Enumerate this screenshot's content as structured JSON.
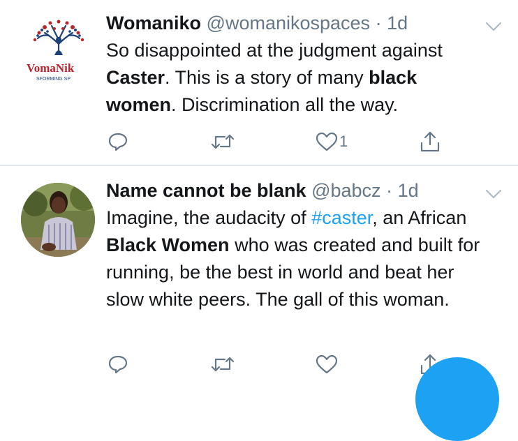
{
  "tweets": [
    {
      "name": "Womaniko",
      "handle": "@womanikospaces",
      "separator": "·",
      "time": "1d",
      "text_parts": [
        {
          "t": "So disappointed at the judgment against "
        },
        {
          "t": "Caster",
          "b": true
        },
        {
          "t": ". This is a story of many "
        },
        {
          "t": "black women",
          "b": true
        },
        {
          "t": ". Discrimination all the way."
        }
      ],
      "avatar": {
        "logo_text": "VomaNik",
        "logo_subtext": "SFORMING SP"
      },
      "actions": {
        "reply_count": "",
        "retweet_count": "",
        "like_count": "1"
      },
      "icons": [
        "reply-icon",
        "retweet-icon",
        "heart-icon",
        "share-icon",
        "chevron-down-icon"
      ]
    },
    {
      "name": "Name cannot be blank",
      "handle": "@babcz",
      "separator": "·",
      "time": "1d",
      "text_parts": [
        {
          "t": "Imagine, the audacity of "
        },
        {
          "t": "#caster",
          "h": true
        },
        {
          "t": ", an African "
        },
        {
          "t": "Black Women",
          "b": true
        },
        {
          "t": " who was created and built for running, be the best in world and beat her slow white peers. The gall of this woman."
        }
      ],
      "actions": {
        "reply_count": "",
        "retweet_count": "",
        "like_count": ""
      },
      "icons": [
        "reply-icon",
        "retweet-icon",
        "heart-icon",
        "share-icon",
        "chevron-down-icon"
      ]
    }
  ],
  "colors": {
    "accent": "#1da1f2",
    "muted": "#657786",
    "text": "#14171a",
    "divider": "#e1e8ed",
    "logo_red": "#b5272d",
    "logo_navy": "#1d3f7a"
  }
}
